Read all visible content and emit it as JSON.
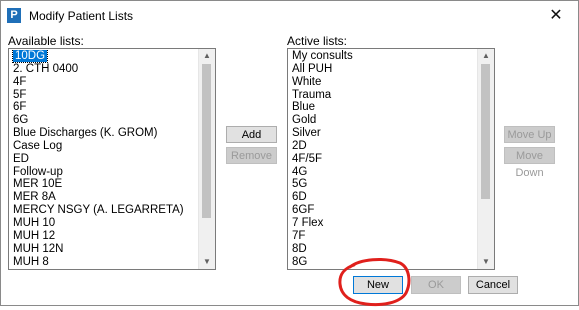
{
  "window": {
    "title": "Modify Patient Lists",
    "close_glyph": "✕"
  },
  "available": {
    "label": "Available lists:",
    "items": [
      "10DG",
      "2. CTH 0400",
      "4F",
      "5F",
      "6F",
      "6G",
      "Blue Discharges   (K. GROM)",
      "Case Log",
      "ED",
      "Follow-up",
      "MER 10E",
      "MER 8A",
      "MERCY NSGY   (A. LEGARRETA)",
      "MUH 10",
      "MUH 12",
      "MUH 12N",
      "MUH 8"
    ],
    "selected_index": 0
  },
  "active": {
    "label": "Active lists:",
    "items": [
      "My consults",
      "All PUH",
      "White",
      "Trauma",
      "Blue",
      "Gold",
      "Silver",
      "2D",
      "4F/5F",
      "4G",
      "5G",
      "6D",
      "6GF",
      "7 Flex",
      "7F",
      "8D",
      "8G"
    ]
  },
  "buttons": {
    "add": "Add",
    "remove": "Remove",
    "move_up": "Move Up",
    "move_down": "Move Down",
    "new": "New",
    "ok": "OK",
    "cancel": "Cancel"
  },
  "colors": {
    "selection": "#0078d7",
    "annotation": "#e0201c",
    "app_icon": "#1f6fb8"
  },
  "icons": {
    "app": "patient-app-icon",
    "close": "close-icon"
  }
}
